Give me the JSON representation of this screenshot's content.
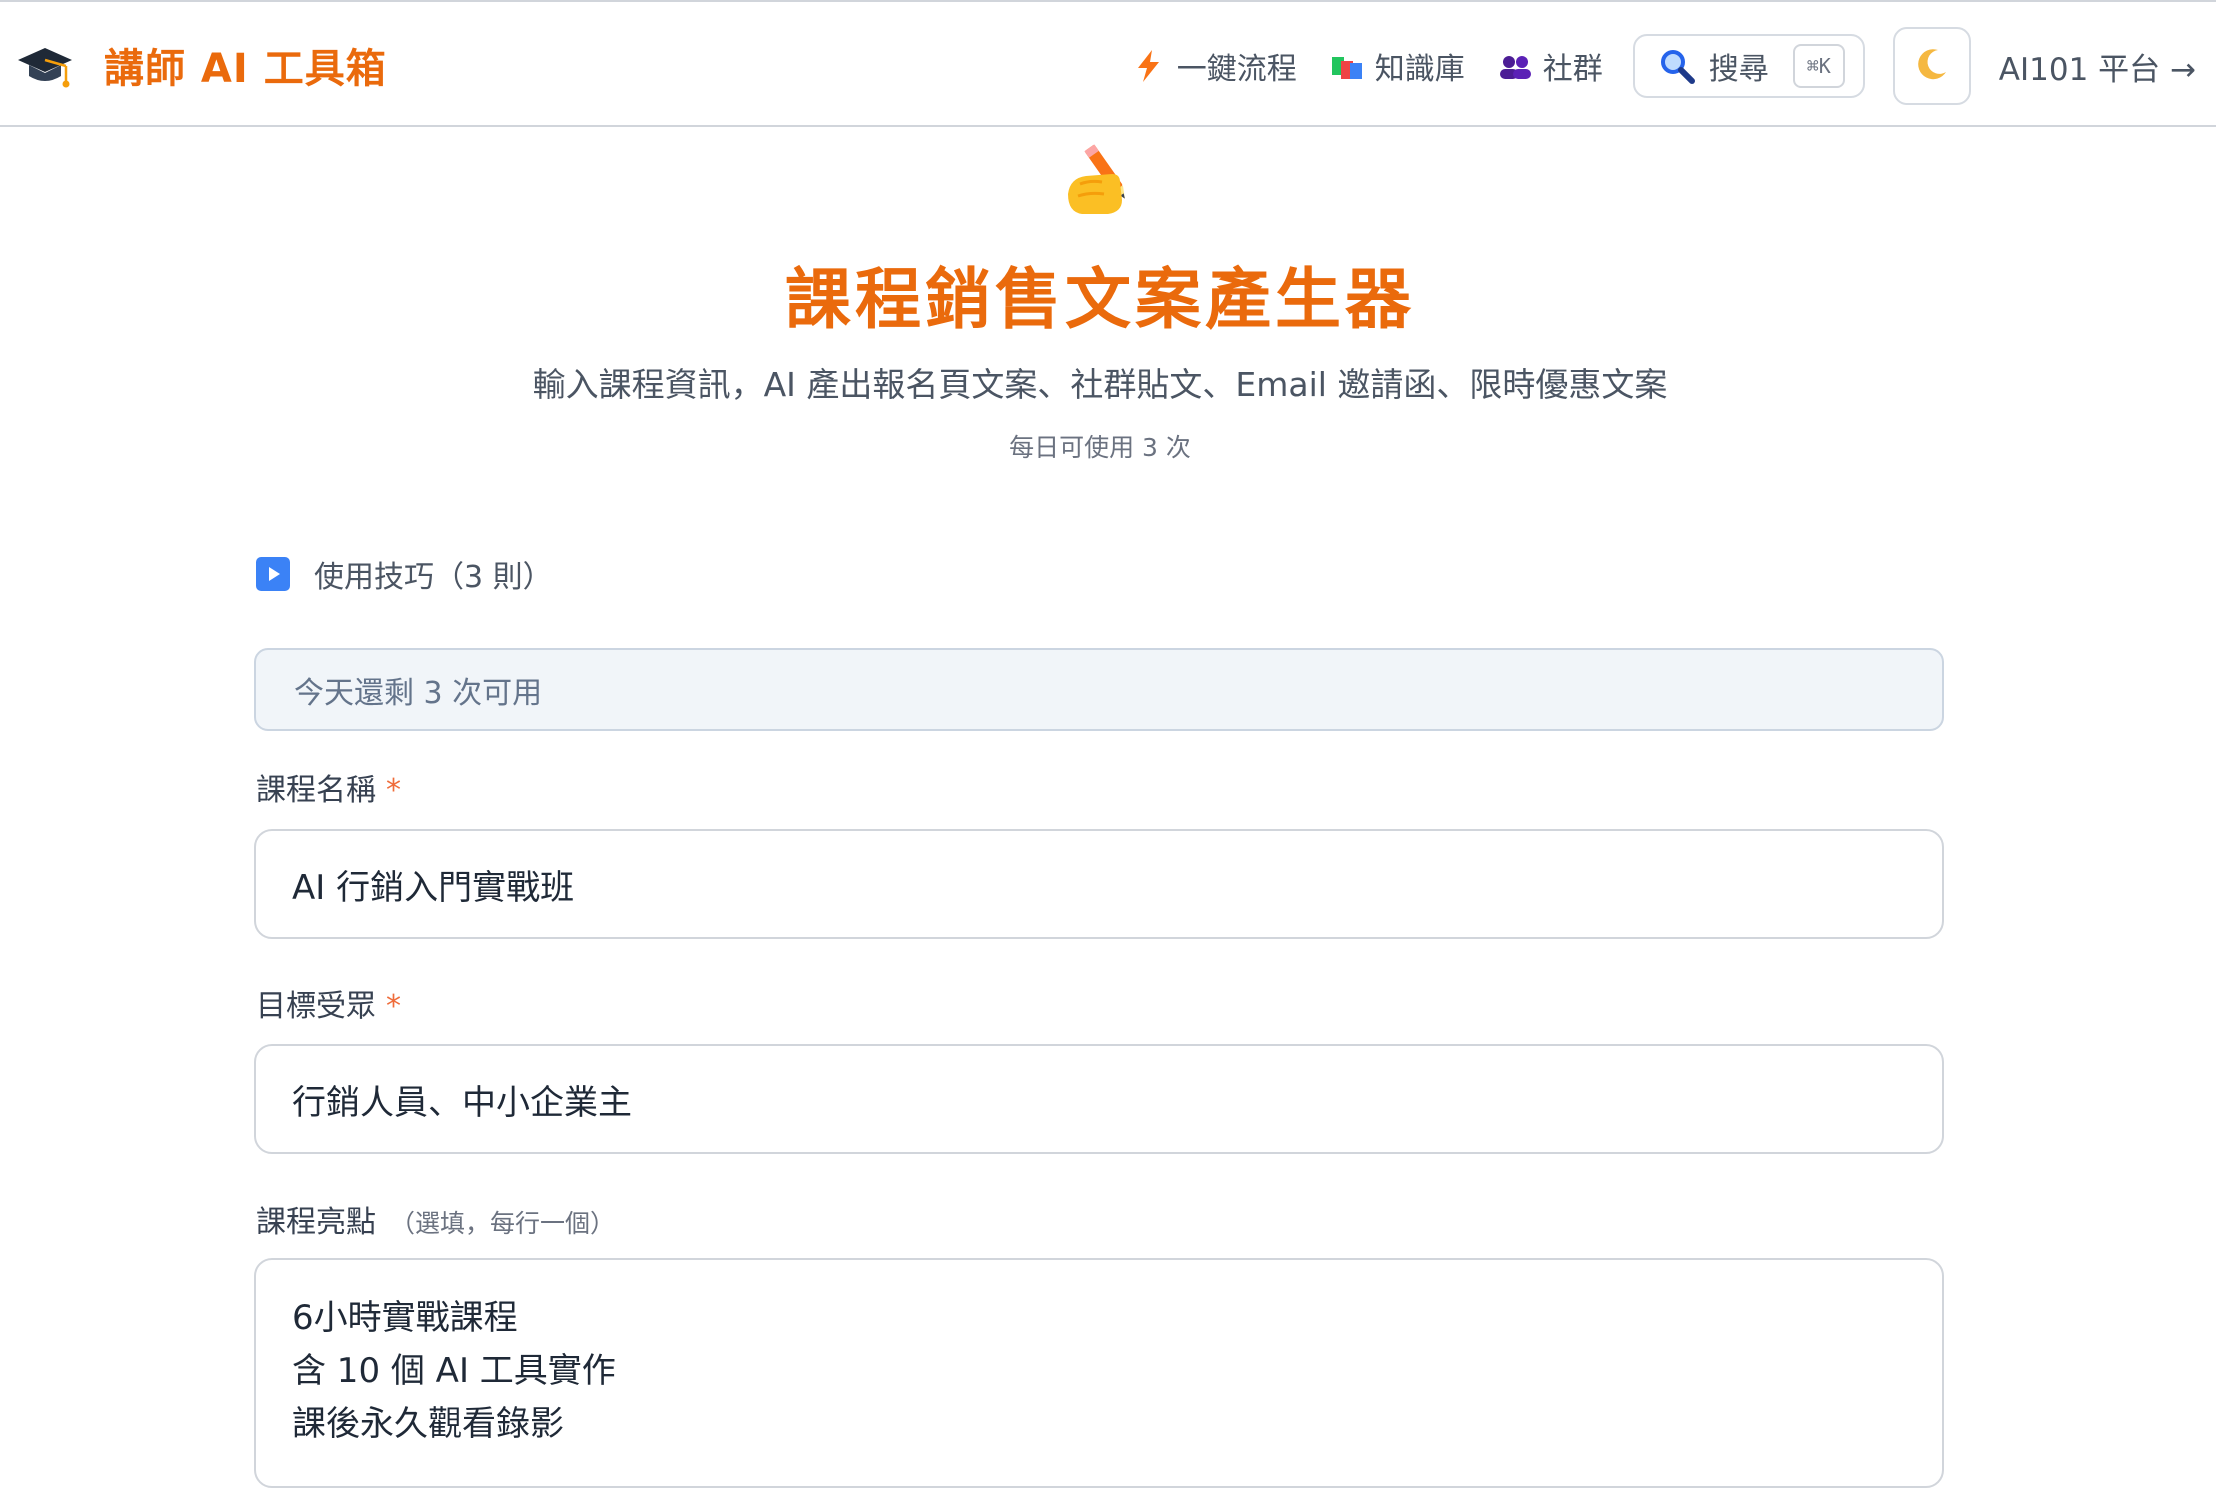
{
  "header": {
    "brand": "講師 AI 工具箱",
    "nav": [
      {
        "label": "一鍵流程",
        "icon": "lightning-icon"
      },
      {
        "label": "知識庫",
        "icon": "books-icon"
      },
      {
        "label": "社群",
        "icon": "people-icon"
      }
    ],
    "search_label": "搜尋",
    "search_shortcut": "⌘K",
    "platform_link": "AI101 平台 →"
  },
  "hero": {
    "title": "課程銷售文案產生器",
    "subtitle": "輸入課程資訊，AI 產出報名頁文案、社群貼文、Email 邀請函、限時優惠文案",
    "quota": "每日可使用 3 次"
  },
  "tips": {
    "label": "使用技巧（3 則）"
  },
  "form": {
    "remaining": "今天還剩 3 次可用",
    "course_name": {
      "label": "課程名稱",
      "required_mark": "*",
      "value": "AI 行銷入門實戰班"
    },
    "audience": {
      "label": "目標受眾",
      "required_mark": "*",
      "value": "行銷人員、中小企業主"
    },
    "highlights": {
      "label": "課程亮點",
      "hint": "（選填，每行一個）",
      "lines": [
        "6小時實戰課程",
        "含 10 個 AI 工具實作",
        "課後永久觀看錄影"
      ]
    }
  },
  "colors": {
    "accent": "#ea6a0c",
    "required": "#ef6c3a",
    "tip_icon": "#3b82f6"
  }
}
